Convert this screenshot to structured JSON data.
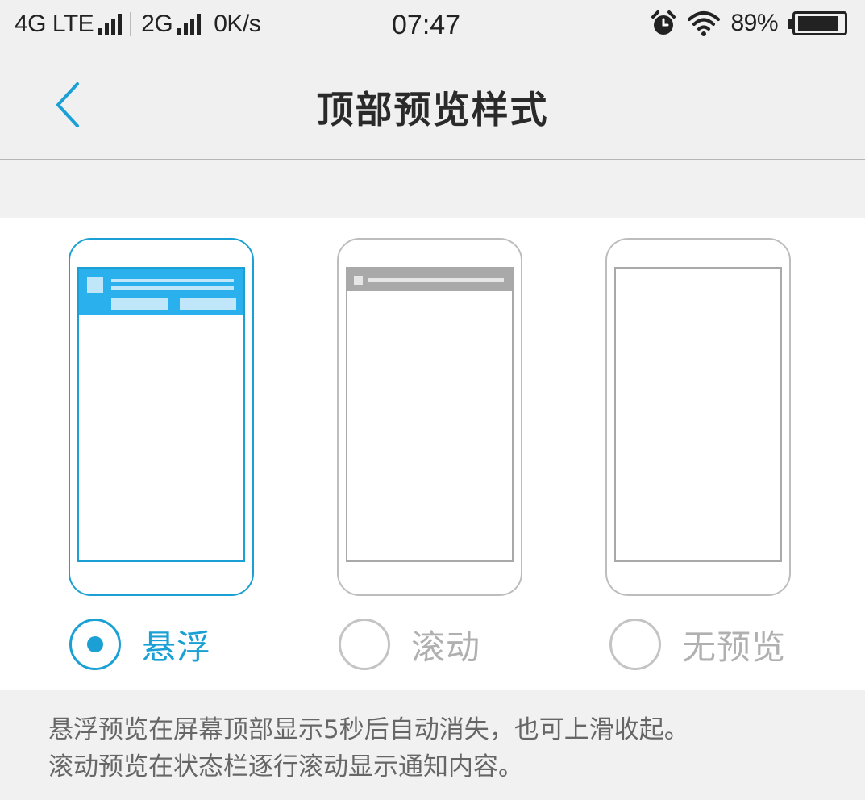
{
  "status_bar": {
    "network1": "4G LTE",
    "network2": "2G",
    "speed": "0K/s",
    "time": "07:47",
    "battery": "89%",
    "battery_level": 0.89,
    "icons": [
      "signal-icon",
      "alarm-icon",
      "wifi-icon",
      "battery-icon"
    ]
  },
  "header": {
    "title": "顶部预览样式",
    "back_icon": "chevron-left-icon"
  },
  "options": [
    {
      "label": "悬浮",
      "selected": true
    },
    {
      "label": "滚动",
      "selected": false
    },
    {
      "label": "无预览",
      "selected": false
    }
  ],
  "description": {
    "line1": "悬浮预览在屏幕顶部显示5秒后自动消失，也可上滑收起。",
    "line2": "滚动预览在状态栏逐行滚动显示通知内容。"
  },
  "colors": {
    "accent": "#1aa0d4",
    "banner": "#2ab0ec",
    "unselected": "#b0b0b0"
  }
}
